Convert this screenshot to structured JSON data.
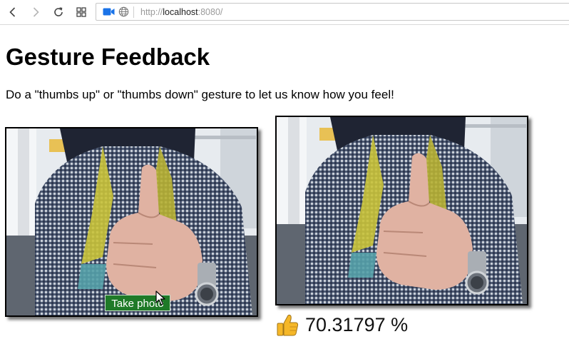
{
  "browser": {
    "url": {
      "scheme": "http://",
      "host": "localhost",
      "rest": ":8080/"
    },
    "icons": {
      "back": "back-arrow-icon",
      "forward": "forward-arrow-icon",
      "refresh": "refresh-icon",
      "tabs": "tabs-grid-icon",
      "camera": "camera-in-use-icon",
      "site": "globe-icon"
    },
    "camera_color": "#1a73e8"
  },
  "page": {
    "title": "Gesture Feedback",
    "instruction": "Do a \"thumbs up\" or \"thumbs down\" gesture to let us know how you feel!",
    "take_photo_label": "Take photo",
    "button_color": "#1f7a28"
  },
  "result": {
    "icon": "thumbs-up-icon",
    "icon_color": "#f5b728",
    "value": "70.31797 %"
  },
  "images": {
    "live": "webcam-feed-thumbs-up",
    "snapshot": "captured-photo-thumbs-up"
  }
}
